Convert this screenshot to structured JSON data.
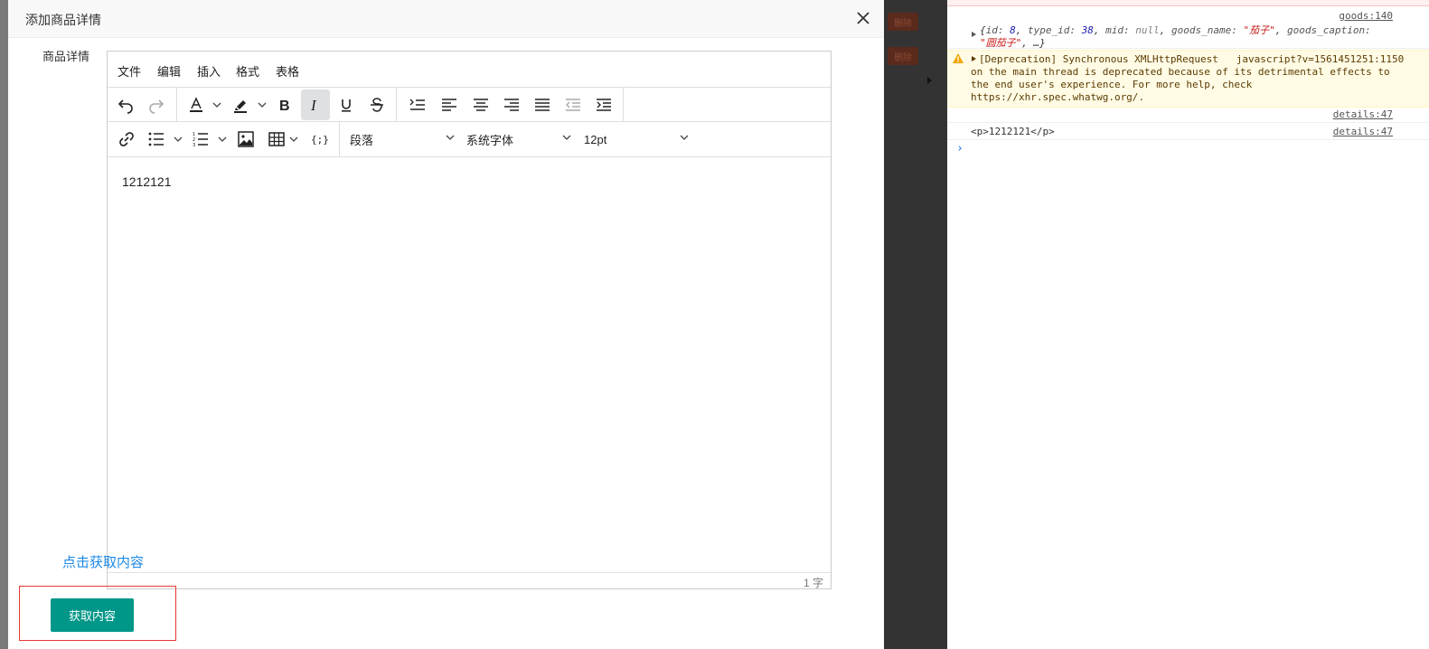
{
  "modal": {
    "title": "添加商品详情",
    "field_label": "商品详情",
    "close_icon": "close-icon"
  },
  "editor": {
    "menus": [
      "文件",
      "编辑",
      "插入",
      "格式",
      "表格"
    ],
    "block_format": "段落",
    "font_family": "系统字体",
    "font_size": "12pt",
    "content": "1212121",
    "word_count": "1 字",
    "toolbar_icons": [
      "undo-icon",
      "redo-icon",
      "text-color-icon",
      "highlight-icon",
      "bold-icon",
      "italic-icon",
      "underline-icon",
      "strikethrough-icon",
      "line-height-icon",
      "align-left-icon",
      "align-center-icon",
      "align-right-icon",
      "align-justify-icon",
      "outdent-icon",
      "indent-icon",
      "link-icon",
      "bullet-list-icon",
      "numbered-list-icon",
      "image-icon",
      "table-icon",
      "code-sample-icon"
    ],
    "active_button": "italic"
  },
  "actions": {
    "get_content_link": "点击获取内容",
    "get_content_button": "获取内容"
  },
  "backdrop": {
    "delete_label": "删除"
  },
  "console": {
    "entry1": {
      "source": "goods:140",
      "line1_prefix": "{",
      "id_key": "id:",
      "id_val": "8",
      "type_key": "type_id:",
      "type_val": "38",
      "mid_key": "mid:",
      "mid_val": "null",
      "name_key": "goods_name:",
      "name_val": "\"茄子\"",
      "caption_key": "goods_caption:",
      "caption_val": "\"圆茄子\"",
      "suffix": ", …}"
    },
    "warning": {
      "source": "javascript?v=1561451251:1150",
      "prefix": "[Deprecation] Synchronous XMLHttpRequest",
      "body": "on the main thread is deprecated because of its detrimental effects to the end user's experience. For more help, check",
      "link": "https://xhr.spec.whatwg.org/",
      "end": "."
    },
    "entry3": {
      "source": "details:47"
    },
    "entry4": {
      "source": "details:47",
      "text": "<p>1212121</p>"
    },
    "prompt": "›"
  },
  "colors": {
    "accent_button": "#009688",
    "link": "#1e88e5",
    "highlight_border": "#e53935",
    "warning_bg": "#fffbe5"
  }
}
